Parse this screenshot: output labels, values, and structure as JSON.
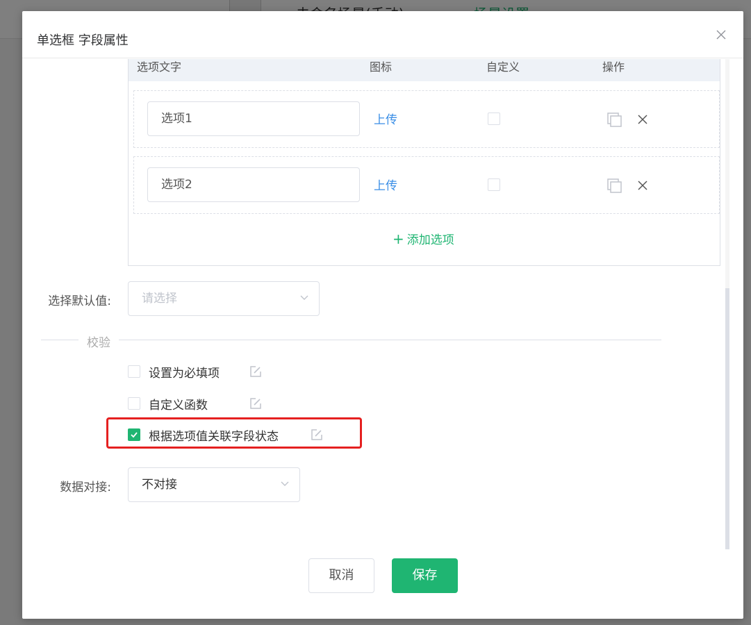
{
  "background": {
    "title": "未命名场景(手动)",
    "tab": "场景设置"
  },
  "dialog": {
    "title": "单选框 字段属性"
  },
  "options": {
    "headers": {
      "text": "选项文字",
      "icon": "图标",
      "custom": "自定义",
      "action": "操作"
    },
    "rows": [
      {
        "value": "选项1",
        "upload": "上传",
        "custom_checked": false
      },
      {
        "value": "选项2",
        "upload": "上传",
        "custom_checked": false
      }
    ],
    "add_label": "添加选项"
  },
  "default_value": {
    "label": "选择默认值:",
    "placeholder": "请选择"
  },
  "validation": {
    "divider": "校验",
    "items": [
      {
        "label": "设置为必填项",
        "checked": false
      },
      {
        "label": "自定义函数",
        "checked": false
      },
      {
        "label": "根据选项值关联字段状态",
        "checked": true
      }
    ]
  },
  "data_link": {
    "label": "数据对接:",
    "value": "不对接"
  },
  "footer": {
    "cancel": "取消",
    "save": "保存"
  },
  "colors": {
    "accent": "#1fb572",
    "link": "#3a8ee6",
    "highlight": "#e52020"
  }
}
